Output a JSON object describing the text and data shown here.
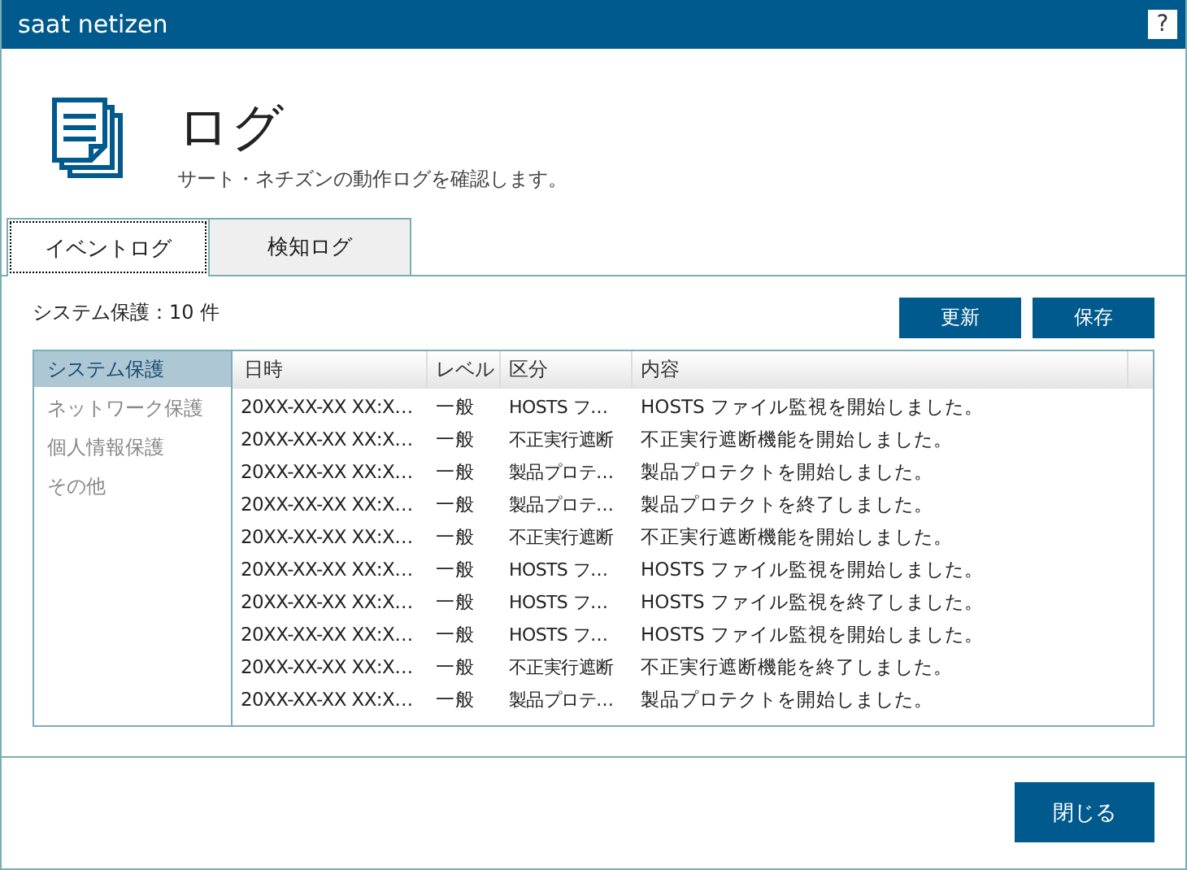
{
  "window": {
    "title": "saat netizen",
    "help": "?"
  },
  "header": {
    "title": "ログ",
    "subtitle": "サート・ネチズンの動作ログを確認します。"
  },
  "tabs": [
    {
      "label": "イベントログ",
      "selected": true
    },
    {
      "label": "検知ログ",
      "selected": false
    }
  ],
  "count": "システム保護：10 件",
  "buttons": [
    "更新",
    "保存"
  ],
  "sidebar": {
    "items": [
      {
        "label": "システム保護",
        "selected": true
      },
      {
        "label": "ネットワーク保護",
        "selected": false
      },
      {
        "label": "個人情報保護",
        "selected": false
      },
      {
        "label": "その他",
        "selected": false
      }
    ]
  },
  "table": {
    "columns": [
      "日時",
      "レベル",
      "区分",
      "内容"
    ],
    "rows": [
      [
        "20XX-XX-XX XX:X…",
        "一般",
        "HOSTS フ…",
        "HOSTS ファイル監視を開始しました。"
      ],
      [
        "20XX-XX-XX XX:X…",
        "一般",
        "不正実行遮断",
        "不正実行遮断機能を開始しました。"
      ],
      [
        "20XX-XX-XX XX:X…",
        "一般",
        "製品プロテ…",
        "製品プロテクトを開始しました。"
      ],
      [
        "20XX-XX-XX XX:X…",
        "一般",
        "製品プロテ…",
        "製品プロテクトを終了しました。"
      ],
      [
        "20XX-XX-XX XX:X…",
        "一般",
        "不正実行遮断",
        "不正実行遮断機能を開始しました。"
      ],
      [
        "20XX-XX-XX XX:X…",
        "一般",
        "HOSTS フ…",
        "HOSTS ファイル監視を開始しました。"
      ],
      [
        "20XX-XX-XX XX:X…",
        "一般",
        "HOSTS フ…",
        "HOSTS ファイル監視を終了しました。"
      ],
      [
        "20XX-XX-XX XX:X…",
        "一般",
        "HOSTS フ…",
        "HOSTS ファイル監視を開始しました。"
      ],
      [
        "20XX-XX-XX XX:X…",
        "一般",
        "不正実行遮断",
        "不正実行遮断機能を終了しました。"
      ],
      [
        "20XX-XX-XX XX:X…",
        "一般",
        "製品プロテ…",
        "製品プロテクトを開始しました。"
      ]
    ]
  },
  "footer": {
    "close": "閉じる"
  }
}
